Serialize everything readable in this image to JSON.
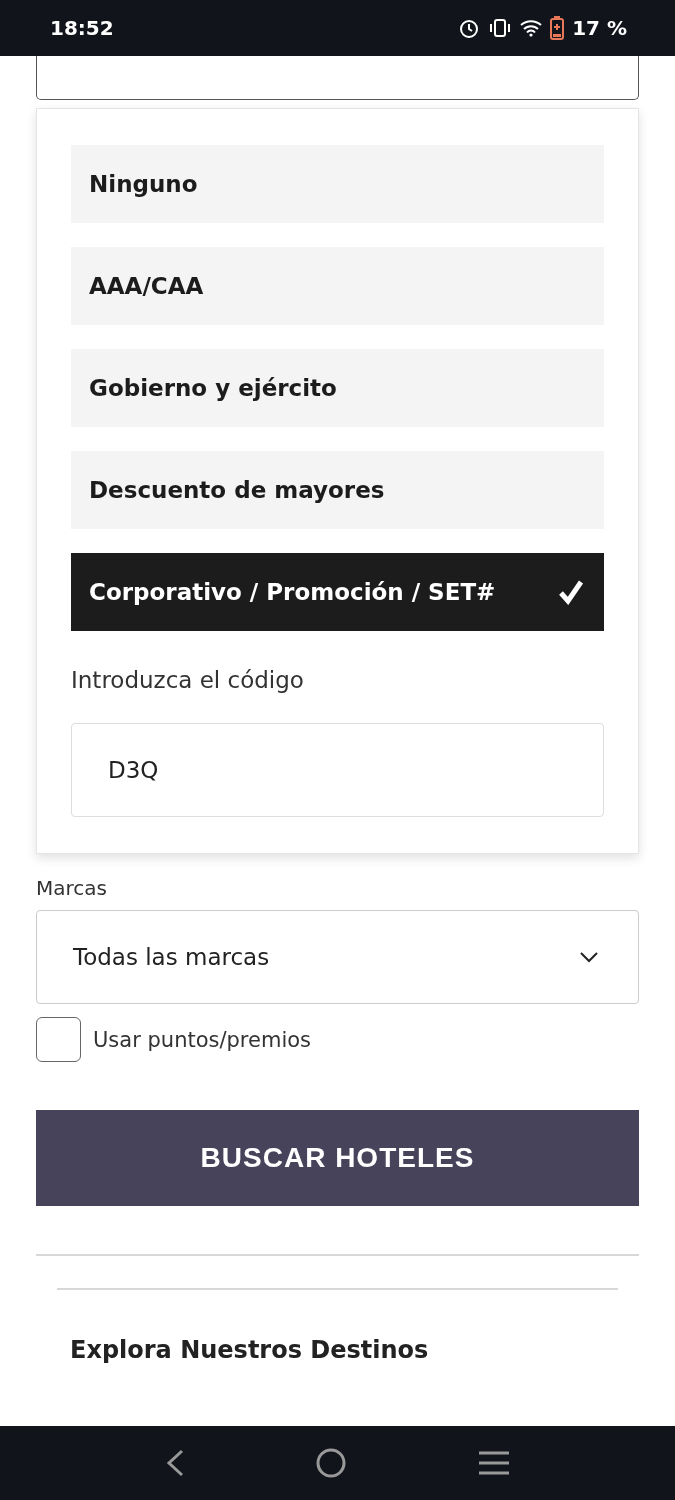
{
  "status_bar": {
    "time": "18:52",
    "battery": "17 %"
  },
  "discount_options": [
    {
      "label": "Ninguno",
      "selected": false
    },
    {
      "label": "AAA/CAA",
      "selected": false
    },
    {
      "label": "Gobierno y ejército",
      "selected": false
    },
    {
      "label": "Descuento de mayores",
      "selected": false
    },
    {
      "label": "Corporativo / Promoción / SET#",
      "selected": true
    }
  ],
  "code_field": {
    "label": "Introduzca el código",
    "value": "D3Q"
  },
  "brands": {
    "label": "Marcas",
    "value": "Todas las marcas"
  },
  "use_points": {
    "label": "Usar puntos/premios",
    "checked": false
  },
  "search_button": "BUSCAR HOTELES",
  "explore_heading": "Explora Nuestros Destinos"
}
